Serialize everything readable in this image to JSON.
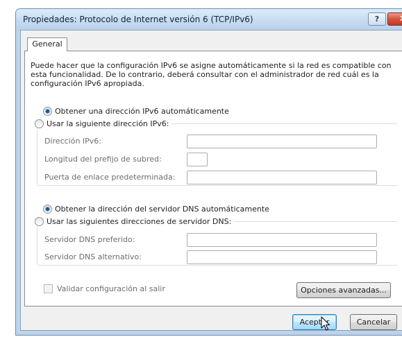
{
  "window": {
    "title": "Propiedades: Protocolo de Internet versión 6 (TCP/IPv6)",
    "help_label": "?",
    "close_label": "✕"
  },
  "tabs": [
    {
      "label": "General",
      "selected": true
    }
  ],
  "general": {
    "description": "Puede hacer que la configuración IPv6 se asigne automáticamente si la red es compatible con esta funcionalidad. De lo contrario, deberá consultar con el administrador de red cuál es la configuración IPv6 apropiada.",
    "ip_auto_label": "Obtener una dirección IPv6 automáticamente",
    "ip_auto_selected": true,
    "ip_manual_label": "Usar la siguiente dirección IPv6:",
    "ipv6_address_label": "Dirección IPv6:",
    "ipv6_address_value": "",
    "prefix_length_label": "Longitud del prefijo de subred:",
    "prefix_length_value": "",
    "gateway_label": "Puerta de enlace predeterminada:",
    "gateway_value": "",
    "dns_auto_label": "Obtener la dirección del servidor DNS automáticamente",
    "dns_auto_selected": true,
    "dns_manual_label": "Usar las siguientes direcciones de servidor DNS:",
    "preferred_dns_label": "Servidor DNS preferido:",
    "preferred_dns_value": "",
    "alternate_dns_label": "Servidor DNS alternativo:",
    "alternate_dns_value": "",
    "validate_label": "Validar configuración al salir",
    "validate_checked": false,
    "advanced_button": "Opciones avanzadas..."
  },
  "footer": {
    "ok_label": "Aceptar",
    "cancel_label": "Cancelar"
  }
}
